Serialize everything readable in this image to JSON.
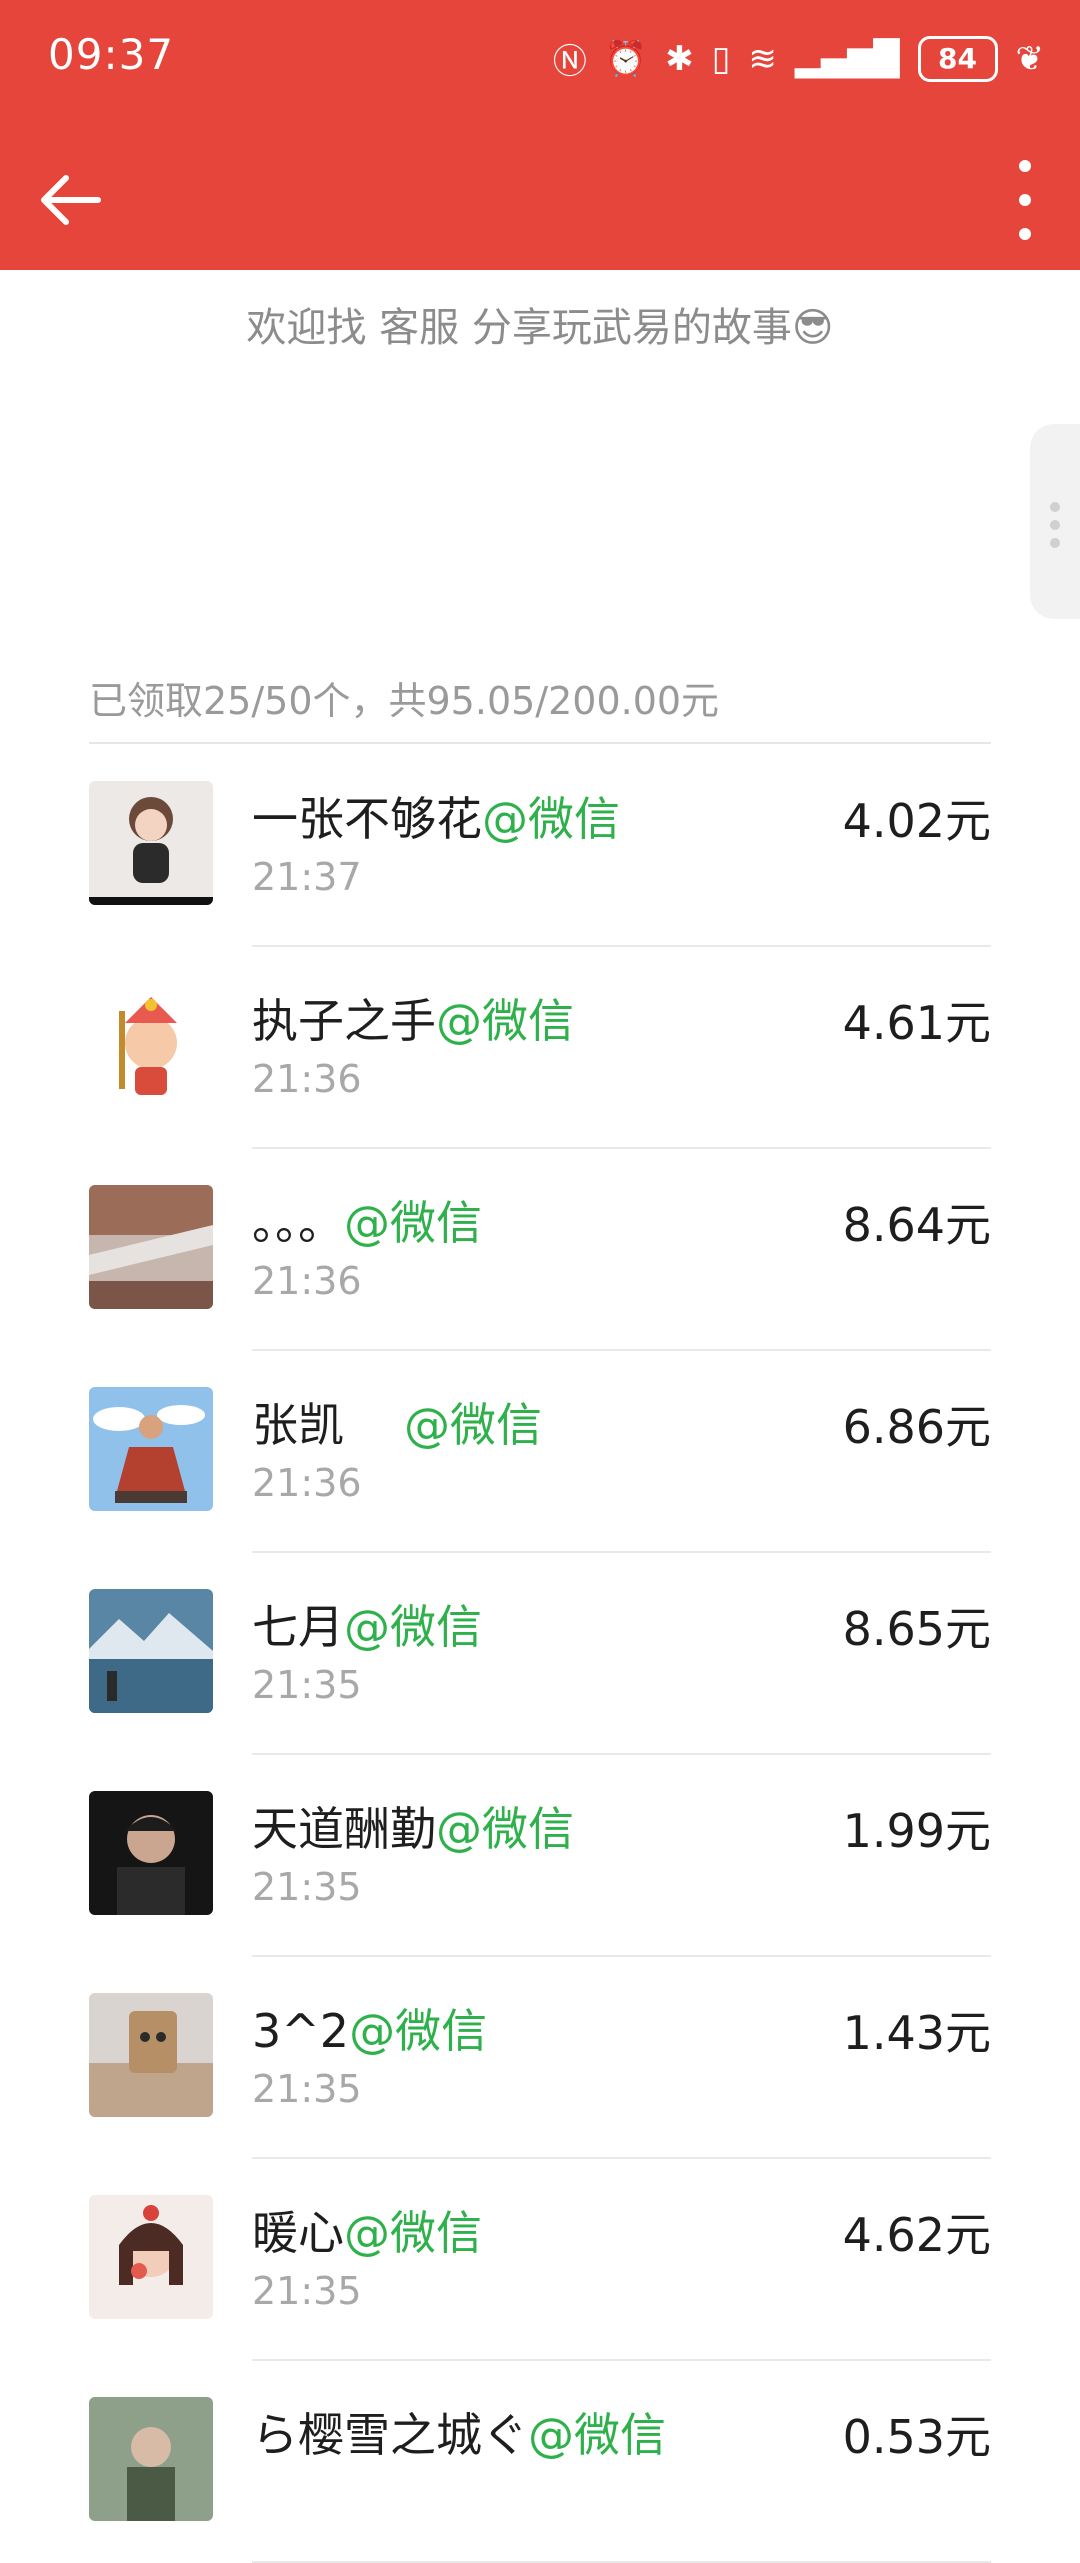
{
  "statusbar": {
    "time": "09:37",
    "battery": "84"
  },
  "content": {
    "blessing": "欢迎找 客服 分享玩武易的故事😎",
    "summary": "已领取25/50个，共95.05/200.00元"
  },
  "tag_label": "@微信",
  "records": [
    {
      "name": "一张不够花",
      "time": "21:37",
      "amount": "4.02元"
    },
    {
      "name": "执子之手",
      "time": "21:36",
      "amount": "4.61元"
    },
    {
      "name": "。。。",
      "time": "21:36",
      "amount": "8.64元"
    },
    {
      "name": "张凯",
      "time": "21:36",
      "amount": "6.86元"
    },
    {
      "name": "七月",
      "time": "21:35",
      "amount": "8.65元"
    },
    {
      "name": "天道酬勤",
      "time": "21:35",
      "amount": "1.99元"
    },
    {
      "name": "3^2",
      "time": "21:35",
      "amount": "1.43元"
    },
    {
      "name": "暖心",
      "time": "21:35",
      "amount": "4.62元"
    },
    {
      "name": "ら樱雪之城ぐ",
      "time": "",
      "amount": "0.53元"
    }
  ]
}
